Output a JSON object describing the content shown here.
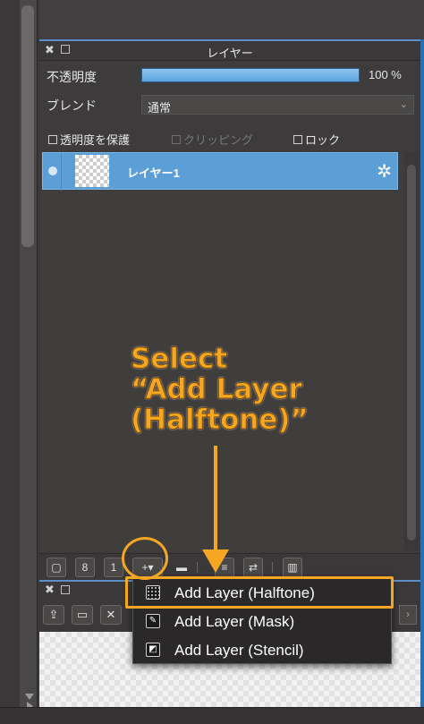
{
  "layer_panel": {
    "title": "レイヤー",
    "opacity_label": "不透明度",
    "opacity_value": "100 %",
    "opacity_fraction": 1.0,
    "blend_label": "ブレンド",
    "blend_value": "通常",
    "checkboxes": {
      "protect_alpha": "透明度を保護",
      "clipping": "クリッピング",
      "lock": "ロック"
    },
    "layers": [
      {
        "name": "レイヤー1"
      }
    ],
    "accent_color": "#5b9fd6"
  },
  "add_layer_menu": {
    "items": [
      {
        "label": "Add Layer (Halftone)",
        "icon": "halftone-layer-icon"
      },
      {
        "label": "Add Layer (Mask)",
        "icon": "mask-layer-icon"
      },
      {
        "label": "Add Layer (Stencil)",
        "icon": "stencil-layer-icon"
      }
    ]
  },
  "annotation": {
    "line1": "Select",
    "line2": "“Add Layer",
    "line3": "(Halftone)”",
    "color": "#f5a623"
  }
}
